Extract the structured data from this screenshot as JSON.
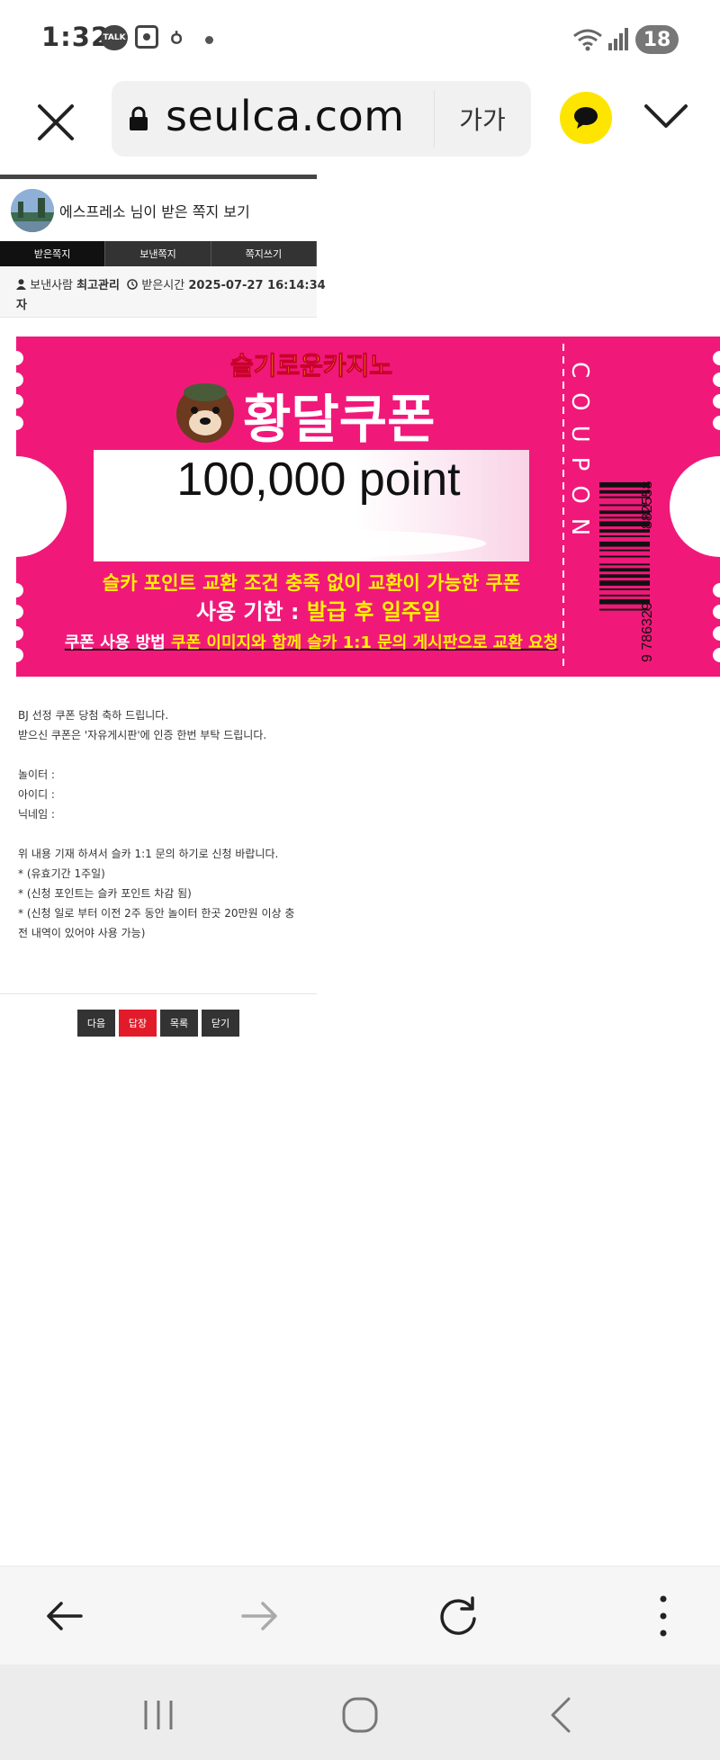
{
  "status_bar": {
    "time": "1:32",
    "talk_badge": "TALK",
    "battery": "18"
  },
  "browser": {
    "url": "seulca.com",
    "text_size_label": "가가"
  },
  "message": {
    "title": "에스프레소 님이 받은 쪽지 보기",
    "tabs": [
      {
        "label": "받은쪽지",
        "active": true
      },
      {
        "label": "보낸쪽지",
        "active": false
      },
      {
        "label": "쪽지쓰기",
        "active": false
      }
    ],
    "sender_label": "보낸사람",
    "sender_name": "최고관리",
    "sender_name_cont": "자",
    "received_label": "받은시간",
    "received_time": "2025-07-27 16:14:34"
  },
  "coupon": {
    "brand": "슬기로운카지노",
    "title": "황달쿠폰",
    "amount": "100,000 point",
    "side_text": "COUPON",
    "barcode_number_left": "9 786329",
    "barcode_number_right": "882558",
    "line1": "슬카 포인트 교환 조건 충족 없이 교환이 가능한 쿠폰",
    "line2_label": "사용 기한 :",
    "line2_value": "발급 후 일주일",
    "line3_label": "쿠폰 사용 방법",
    "line3_value": "쿠폰 이미지와 함께 슬카 1:1 문의 게시판으로 교환 요청",
    "colors": {
      "pink": "#f0197a",
      "yellow": "#fff200"
    }
  },
  "body": {
    "line1": "BJ 선정 쿠폰 당첨 축하 드립니다.",
    "line2": "받으신 쿠폰은 '자유게시판'에 인증 한번 부탁 드립니다.",
    "line3": "놀이터 :",
    "line4": "아이디 :",
    "line5": "닉네임 :",
    "line6": "위 내용 기재 하셔서 슬카 1:1 문의 하기로 신청 바랍니다.",
    "line7": "* (유효기간 1주일)",
    "line8": "* (신청 포인트는 슬카 포인트 차감 됨)",
    "line9": "* (신청 일로 부터 이전 2주 동안 놀이터 한곳 20만원 이상 충",
    "line10": "전 내역이 있어야 사용 가능)"
  },
  "actions": {
    "next": "다음",
    "reply": "답장",
    "list": "목록",
    "close": "닫기"
  }
}
